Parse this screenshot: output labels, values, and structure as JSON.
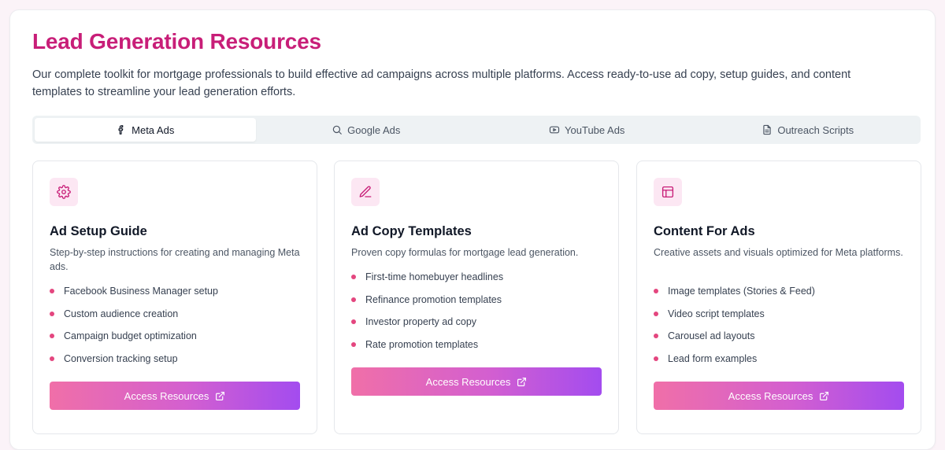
{
  "header": {
    "title": "Lead Generation Resources",
    "description": "Our complete toolkit for mortgage professionals to build effective ad campaigns across multiple platforms. Access ready-to-use ad copy, setup guides, and content templates to streamline your lead generation efforts."
  },
  "tabs": [
    {
      "label": "Meta Ads",
      "icon": "facebook-icon",
      "active": true
    },
    {
      "label": "Google Ads",
      "icon": "search-icon",
      "active": false
    },
    {
      "label": "YouTube Ads",
      "icon": "youtube-icon",
      "active": false
    },
    {
      "label": "Outreach Scripts",
      "icon": "document-icon",
      "active": false
    }
  ],
  "cards": [
    {
      "icon": "gear-icon",
      "title": "Ad Setup Guide",
      "description": "Step-by-step instructions for creating and managing Meta ads.",
      "features": [
        "Facebook Business Manager setup",
        "Custom audience creation",
        "Campaign budget optimization",
        "Conversion tracking setup"
      ],
      "button_label": "Access Resources"
    },
    {
      "icon": "pencil-icon",
      "title": "Ad Copy Templates",
      "description": "Proven copy formulas for mortgage lead generation.",
      "features": [
        "First-time homebuyer headlines",
        "Refinance promotion templates",
        "Investor property ad copy",
        "Rate promotion templates"
      ],
      "button_label": "Access Resources"
    },
    {
      "icon": "layout-icon",
      "title": "Content For Ads",
      "description": "Creative assets and visuals optimized for Meta platforms.",
      "features": [
        "Image templates (Stories & Feed)",
        "Video script templates",
        "Carousel ad layouts",
        "Lead form examples"
      ],
      "button_label": "Access Resources"
    }
  ],
  "colors": {
    "accent": "#c81e78",
    "bullet": "#e4467f",
    "button_start": "#f06fa8",
    "button_end": "#a34cef",
    "icon_bg": "#fce7f3"
  }
}
